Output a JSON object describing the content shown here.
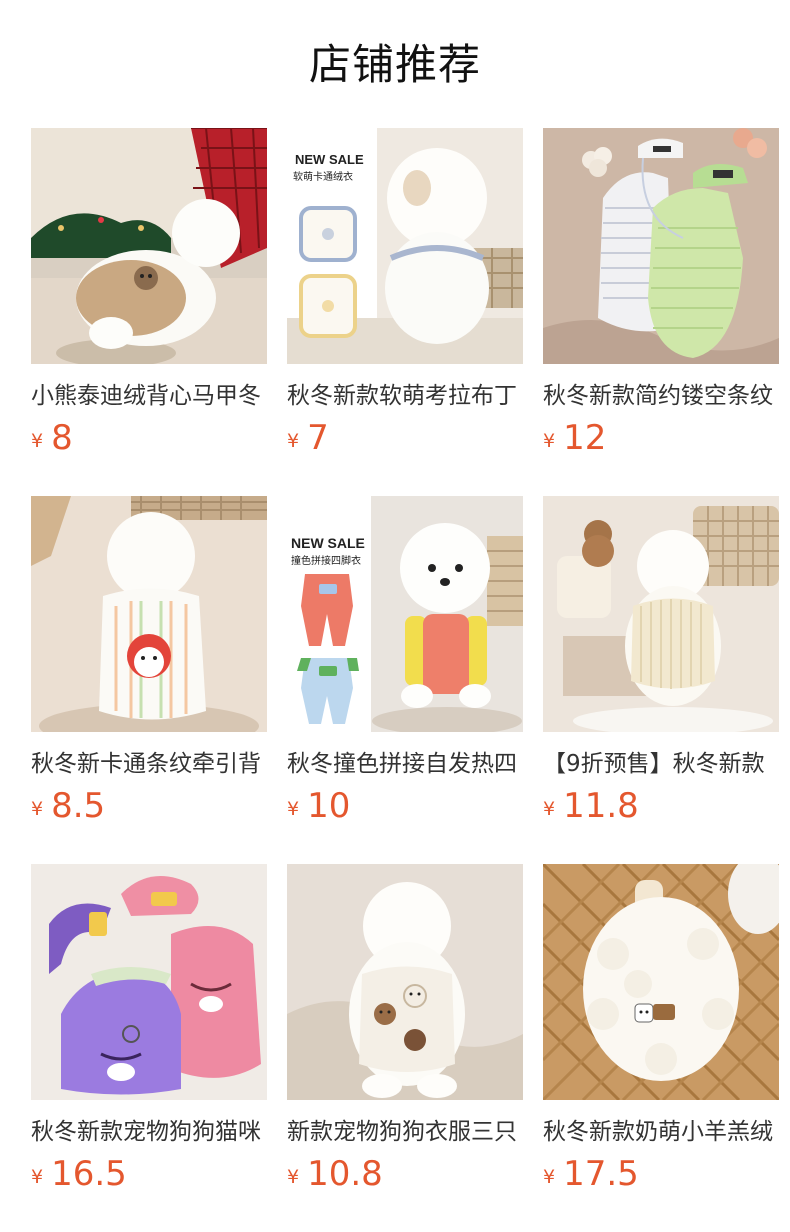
{
  "header": {
    "title": "店铺推荐"
  },
  "products": [
    {
      "name": "小熊泰迪绒背心马甲冬",
      "currency": "¥",
      "price": "8",
      "badge": "",
      "badge_sub": "",
      "icon": "product-photo-teddy-bear-vest"
    },
    {
      "name": "秋冬新款软萌考拉布丁",
      "currency": "¥",
      "price": "7",
      "badge": "NEW SALE",
      "badge_sub": "软萌卡通绒衣",
      "icon": "product-photo-koala-fleece"
    },
    {
      "name": "秋冬新款简约镂空条纹",
      "currency": "¥",
      "price": "12",
      "badge": "",
      "badge_sub": "",
      "icon": "product-photo-knit-tank-set"
    },
    {
      "name": "秋冬新卡通条纹牵引背",
      "currency": "¥",
      "price": "8.5",
      "badge": "",
      "badge_sub": "",
      "icon": "product-photo-striped-harness"
    },
    {
      "name": "秋冬撞色拼接自发热四",
      "currency": "¥",
      "price": "10",
      "badge": "NEW SALE",
      "badge_sub": "撞色拼接四脚衣",
      "icon": "product-photo-color-block-jumpsuit"
    },
    {
      "name": "【9折预售】秋冬新款",
      "currency": "¥",
      "price": "11.8",
      "badge": "",
      "badge_sub": "",
      "icon": "product-photo-cream-knit"
    },
    {
      "name": "秋冬新款宠物狗狗猫咪",
      "currency": "¥",
      "price": "16.5",
      "badge": "",
      "badge_sub": "",
      "icon": "product-photo-plush-vests"
    },
    {
      "name": "新款宠物狗狗衣服三只",
      "currency": "¥",
      "price": "10.8",
      "badge": "",
      "badge_sub": "",
      "icon": "product-photo-three-bears-vest"
    },
    {
      "name": "秋冬新款奶萌小羊羔绒",
      "currency": "¥",
      "price": "17.5",
      "badge": "",
      "badge_sub": "",
      "icon": "product-photo-lamb-fleece"
    }
  ]
}
